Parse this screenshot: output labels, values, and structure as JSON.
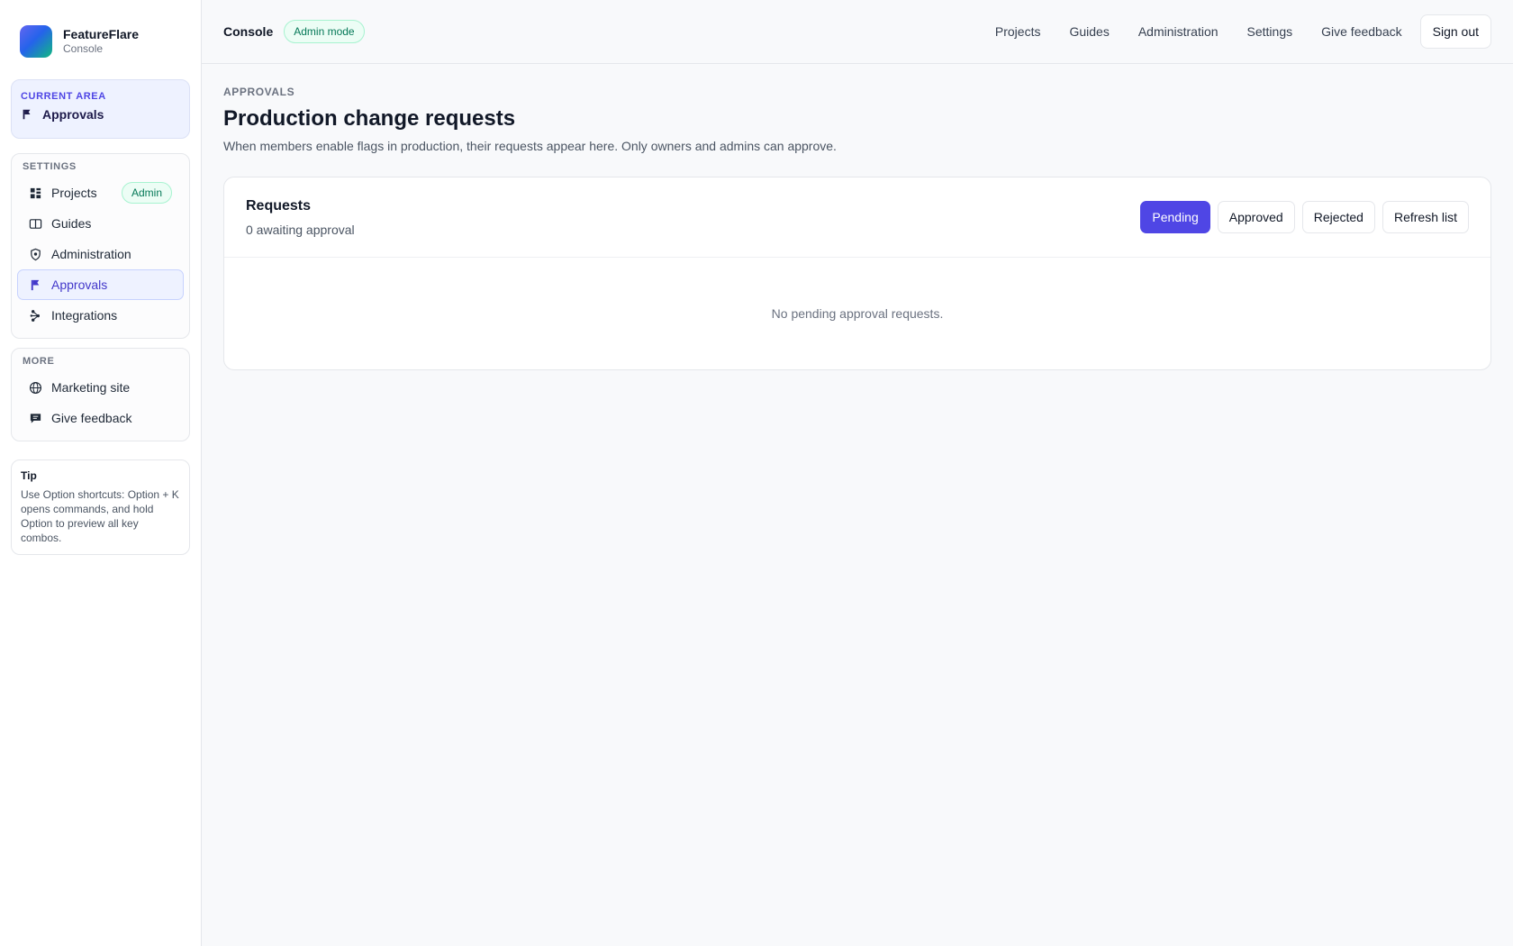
{
  "brand": {
    "name": "FeatureFlare",
    "sub": "Console"
  },
  "current_area": {
    "label": "CURRENT AREA",
    "value": "Approvals",
    "icon": "flag-icon"
  },
  "sidebar": {
    "settings_label": "SETTINGS",
    "items": [
      {
        "label": "Projects",
        "icon": "projects-icon",
        "badge": "Admin"
      },
      {
        "label": "Guides",
        "icon": "book-icon"
      },
      {
        "label": "Administration",
        "icon": "shield-icon"
      },
      {
        "label": "Approvals",
        "icon": "flag-icon",
        "active": true
      },
      {
        "label": "Integrations",
        "icon": "integrations-icon"
      }
    ],
    "more_label": "MORE",
    "more_items": [
      {
        "label": "Marketing site",
        "icon": "globe-icon"
      },
      {
        "label": "Give feedback",
        "icon": "chat-icon"
      }
    ],
    "tip": {
      "title": "Tip",
      "text": "Use Option shortcuts: Option + K opens commands, and hold Option to preview all key combos."
    }
  },
  "topbar": {
    "title": "Console",
    "badge": "Admin mode",
    "links": [
      "Projects",
      "Guides",
      "Administration",
      "Settings",
      "Give feedback"
    ],
    "sign_out": "Sign out"
  },
  "page": {
    "eyebrow": "APPROVALS",
    "title": "Production change requests",
    "description": "When members enable flags in production, their requests appear here. Only owners and admins can approve."
  },
  "requests": {
    "title": "Requests",
    "count_text": "0 awaiting approval",
    "filters": [
      "Pending",
      "Approved",
      "Rejected"
    ],
    "active_filter": "Pending",
    "refresh": "Refresh list",
    "empty": "No pending approval requests."
  },
  "colors": {
    "accent": "#4f46e5",
    "success": "#047857"
  }
}
